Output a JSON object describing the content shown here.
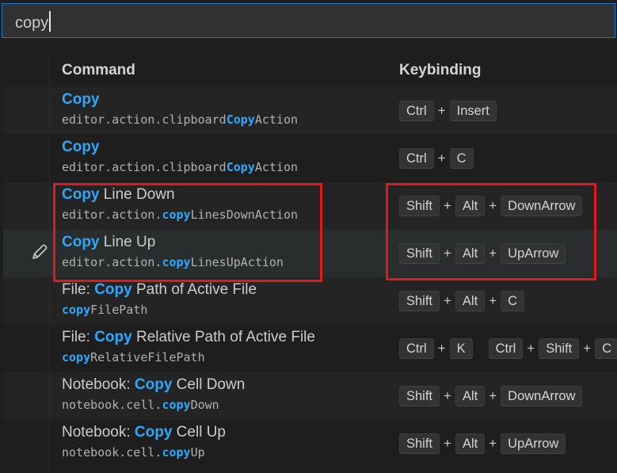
{
  "search": {
    "value": "copy"
  },
  "columns": {
    "command": "Command",
    "keybinding": "Keybinding"
  },
  "rows": [
    {
      "title_prefix": "",
      "title_highlight": "Copy",
      "title_rest": "",
      "id_prefix": "editor.action.clipboard",
      "id_highlight": "Copy",
      "id_rest": "Action",
      "keys": [
        "Ctrl",
        "Insert"
      ]
    },
    {
      "title_prefix": "",
      "title_highlight": "Copy",
      "title_rest": "",
      "id_prefix": "editor.action.clipboard",
      "id_highlight": "Copy",
      "id_rest": "Action",
      "keys": [
        "Ctrl",
        "C"
      ]
    },
    {
      "title_prefix": "",
      "title_highlight": "Copy",
      "title_rest": " Line Down",
      "id_prefix": "editor.action.",
      "id_highlight": "copy",
      "id_rest": "LinesDownAction",
      "keys": [
        "Shift",
        "Alt",
        "DownArrow"
      ]
    },
    {
      "title_prefix": "",
      "title_highlight": "Copy",
      "title_rest": " Line Up",
      "id_prefix": "editor.action.",
      "id_highlight": "copy",
      "id_rest": "LinesUpAction",
      "keys": [
        "Shift",
        "Alt",
        "UpArrow"
      ]
    },
    {
      "title_prefix": "File: ",
      "title_highlight": "Copy",
      "title_rest": " Path of Active File",
      "id_prefix": "",
      "id_highlight": "copy",
      "id_rest": "FilePath",
      "keys": [
        "Shift",
        "Alt",
        "C"
      ]
    },
    {
      "title_prefix": "File: ",
      "title_highlight": "Copy",
      "title_rest": " Relative Path of Active File",
      "id_prefix": "",
      "id_highlight": "copy",
      "id_rest": "RelativeFilePath",
      "keys": [
        "Ctrl",
        "K"
      ],
      "keys2": [
        "Ctrl",
        "Shift",
        "C"
      ]
    },
    {
      "title_prefix": "Notebook: ",
      "title_highlight": "Copy",
      "title_rest": " Cell Down",
      "id_prefix": "notebook.cell.",
      "id_highlight": "copy",
      "id_rest": "Down",
      "keys": [
        "Shift",
        "Alt",
        "DownArrow"
      ]
    },
    {
      "title_prefix": "Notebook: ",
      "title_highlight": "Copy",
      "title_rest": " Cell Up",
      "id_prefix": "notebook.cell.",
      "id_highlight": "copy",
      "id_rest": "Up",
      "keys": [
        "Shift",
        "Alt",
        "UpArrow"
      ]
    }
  ],
  "key_separator": "+",
  "icons": {
    "edit": "pencil-icon"
  },
  "colors": {
    "highlight": "#2aaaff",
    "annotation": "#e0191d",
    "focus_border": "#1d79c7"
  }
}
